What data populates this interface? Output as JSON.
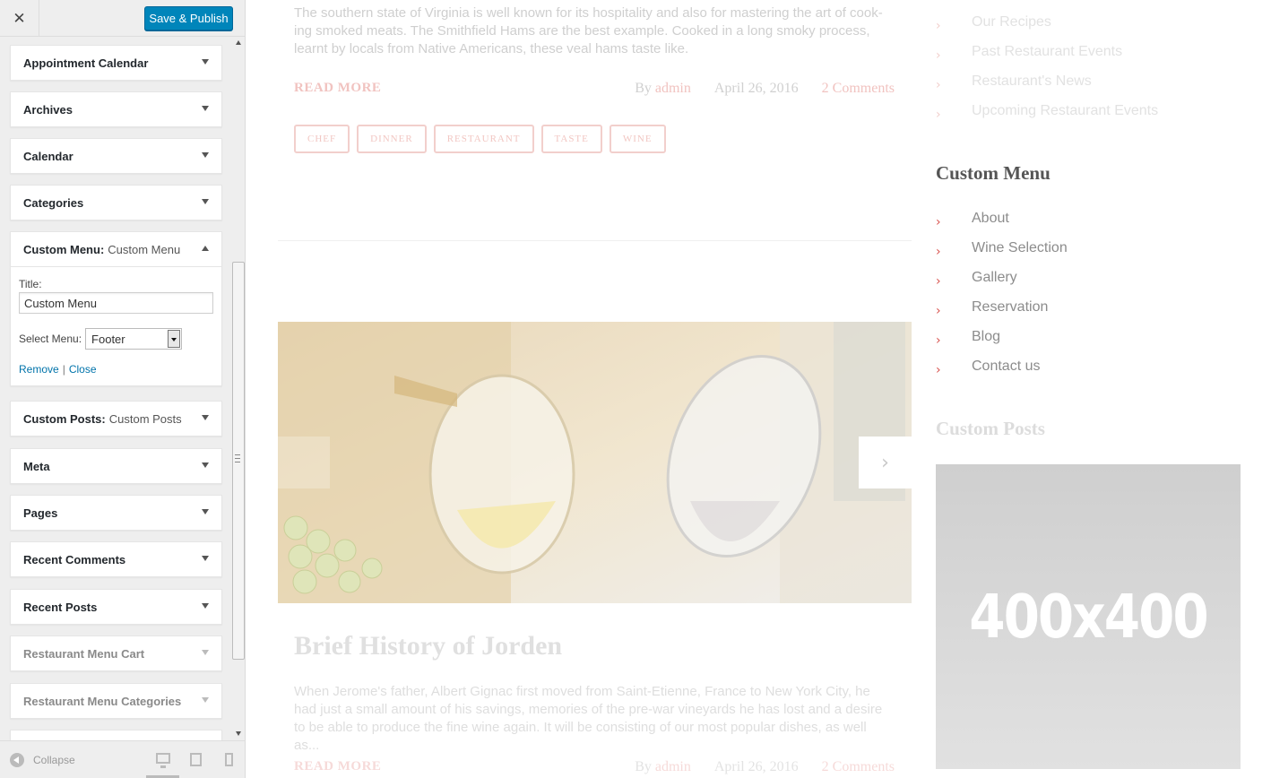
{
  "header": {
    "close_icon": "✕",
    "save_label": "Save & Publish"
  },
  "widgets": [
    {
      "title": "Appointment Calendar",
      "subtitle": ""
    },
    {
      "title": "Archives",
      "subtitle": ""
    },
    {
      "title": "Calendar",
      "subtitle": ""
    },
    {
      "title": "Categories",
      "subtitle": ""
    },
    {
      "title": "Custom Menu:",
      "subtitle": "Custom Menu"
    },
    {
      "title": "Custom Posts:",
      "subtitle": "Custom Posts"
    },
    {
      "title": "Meta",
      "subtitle": ""
    },
    {
      "title": "Pages",
      "subtitle": ""
    },
    {
      "title": "Recent Comments",
      "subtitle": ""
    },
    {
      "title": "Recent Posts",
      "subtitle": ""
    },
    {
      "title": "Restaurant Menu Cart",
      "subtitle": ""
    },
    {
      "title": "Restaurant Menu Categories",
      "subtitle": ""
    }
  ],
  "custom_menu_form": {
    "title_label": "Title:",
    "title_value": "Custom Menu",
    "select_label": "Select Menu:",
    "select_value": "Footer",
    "remove_link": "Remove",
    "separator": "|",
    "close_link": "Close"
  },
  "footer": {
    "collapse_label": "Collapse",
    "active_device": "desktop"
  },
  "preview": {
    "post1": {
      "excerpt": "The southern state of Virginia is well known for its hospitality and also for mastering the art of cook-ing smoked meats. The Smithfield Hams are the best example. Cooked in a long smoky process, learnt by locals from Native Americans, these veal hams taste like.",
      "read_more": "READ MORE",
      "by": "By",
      "author": "admin",
      "date": "April 26, 2016",
      "comments": "2 Comments",
      "tags": [
        "CHEF",
        "DINNER",
        "RESTAURANT",
        "TASTE",
        "WINE"
      ]
    },
    "next_arrow": "›",
    "post2": {
      "title": "Brief History of Jorden",
      "excerpt": "When Jerome's father, Albert Gignac first moved from Saint-Etienne, France to New York City, he had just a small amount of his savings, memories of the pre-war vineyards he has lost and a desire to be able to produce the fine wine again. It will be consisting of our most popular dishes, as well as...",
      "read_more": "READ MORE",
      "by": "By",
      "author": "admin",
      "date": "April 26, 2016",
      "comments": "2 Comments"
    },
    "top_list": [
      "Our Recipes",
      "Past Restaurant Events",
      "Restaurant's News",
      "Upcoming Restaurant Events"
    ],
    "custom_menu_title": "Custom Menu",
    "custom_menu_items": [
      "About",
      "Wine Selection",
      "Gallery",
      "Reservation",
      "Blog",
      "Contact us"
    ],
    "custom_posts_title": "Custom Posts",
    "placeholder_text": "400x400",
    "chevron": "›"
  },
  "colors": {
    "primary_button": "#0085ba",
    "link": "#0073aa",
    "accent": "#d9534f"
  }
}
